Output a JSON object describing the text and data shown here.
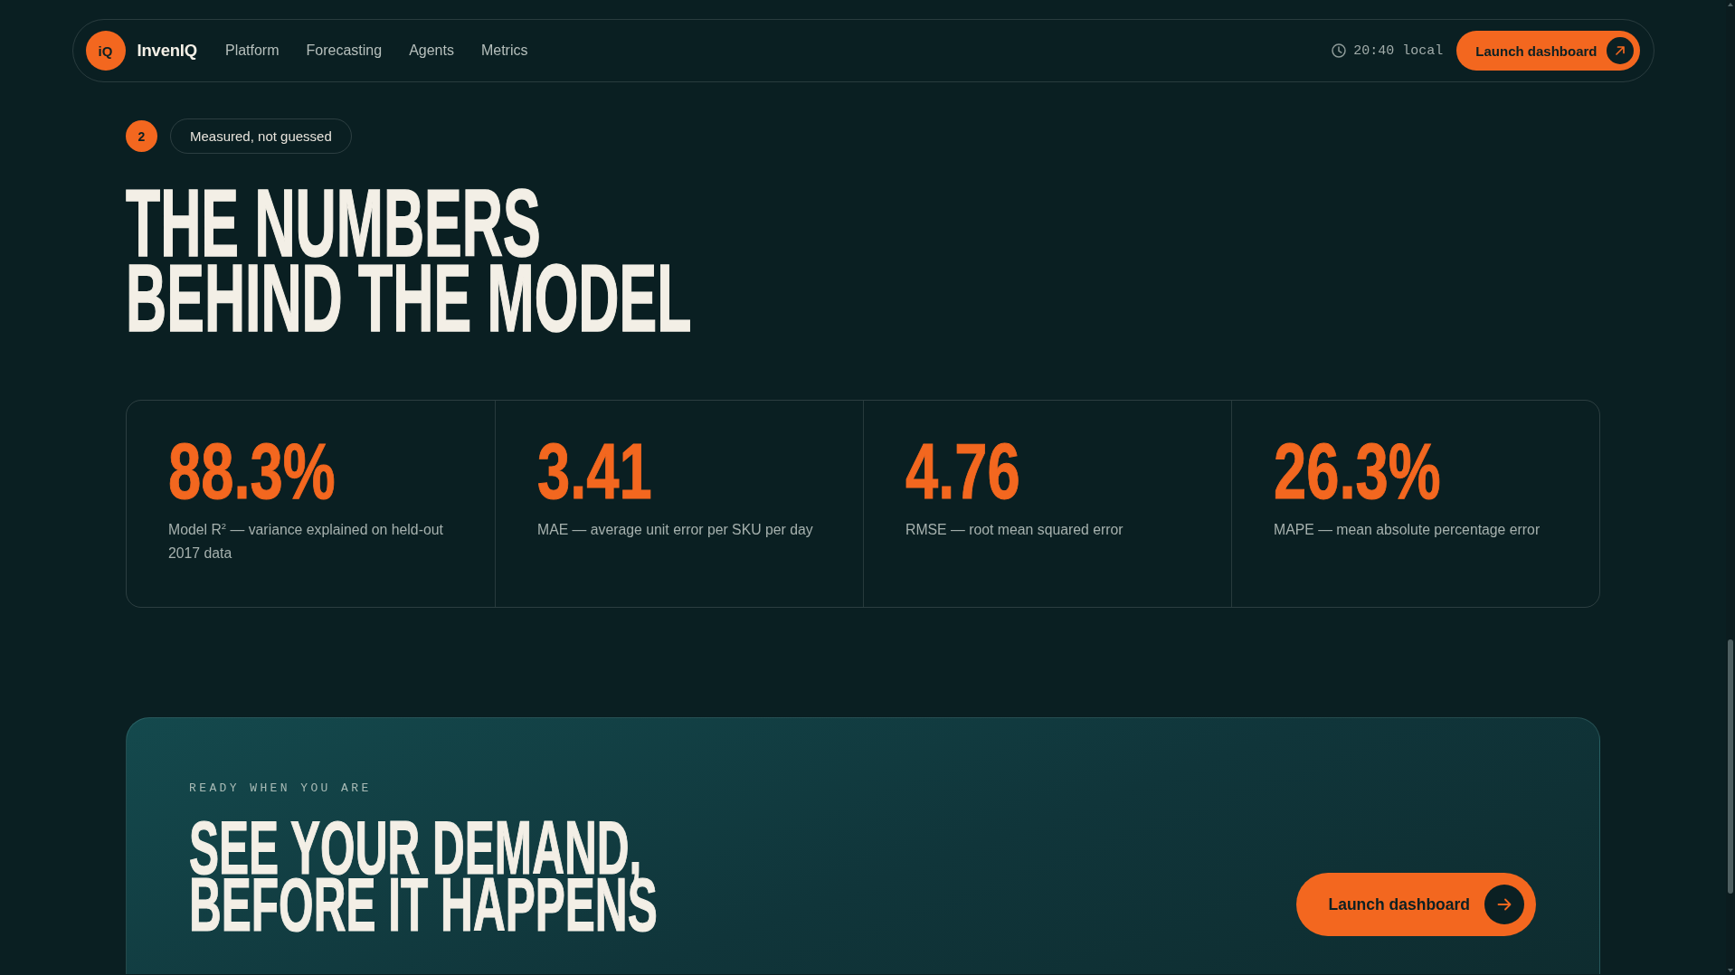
{
  "nav": {
    "logo_mark": "iQ",
    "brand": "InvenIQ",
    "links": [
      "Platform",
      "Forecasting",
      "Agents",
      "Metrics"
    ],
    "clock": "20:40 local",
    "cta": "Launch dashboard"
  },
  "section": {
    "number": "2",
    "tag": "Measured, not guessed",
    "heading_lines": [
      "THE NUMBERS",
      "BEHIND THE MODEL"
    ]
  },
  "stats": [
    {
      "value": "88.3%",
      "description": "Model R$^{2}$ — variance explained on held-out 2017 data"
    },
    {
      "value": "3.41",
      "description": "MAE — average unit error per SKU per day"
    },
    {
      "value": "4.76",
      "description": "RMSE — root mean squared error"
    },
    {
      "value": "26.3%",
      "description": "MAPE — mean absolute percentage error"
    }
  ],
  "cta_banner": {
    "eyebrow": "READY WHEN YOU ARE",
    "heading_lines": [
      "SEE YOUR DEMAND,",
      "BEFORE IT HAPPENS"
    ],
    "button": "Launch dashboard"
  }
}
